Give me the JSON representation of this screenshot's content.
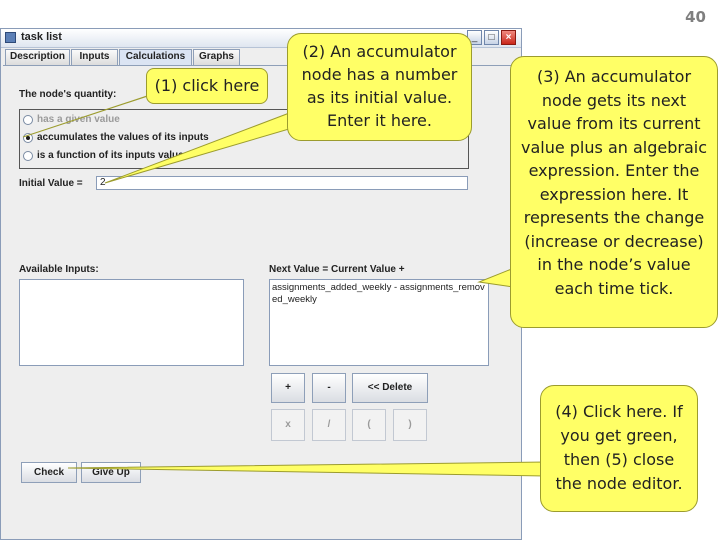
{
  "slide_number": "40",
  "window": {
    "title": "task list",
    "tabs": [
      "Description",
      "Inputs",
      "Calculations",
      "Graphs"
    ],
    "active_tab": "Calculations"
  },
  "quantity": {
    "label": "The node's quantity:",
    "options": [
      {
        "label": "has a given value",
        "selected": false
      },
      {
        "label": "accumulates the values of its inputs",
        "selected": true
      },
      {
        "label": "is a function of its inputs values",
        "selected": false
      }
    ]
  },
  "initial_value": {
    "label": "Initial Value =",
    "value": "2"
  },
  "available_inputs": {
    "label": "Available Inputs:"
  },
  "next_value": {
    "label": "Next Value = Current Value +",
    "expression": "assignments_added_weekly - assignments_removed_weekly"
  },
  "operator_buttons": {
    "plus": "+",
    "minus": "-",
    "delete": "<< Delete",
    "times": "x",
    "divide": "/",
    "open_paren": "(",
    "close_paren": ")"
  },
  "bottom_buttons": {
    "check": "Check",
    "give_up": "Give Up"
  },
  "callouts": {
    "c1": "(1) click here",
    "c2": "(2) An accumulator node has a number as its initial value. Enter it here.",
    "c3": "(3) An accumulator node gets its next value from its current value plus an algebraic expression. Enter the expression here.  It represents the change (increase or decrease) in the node’s value each time tick.",
    "c4": "(4) Click here.  If you get green, then (5) close the node editor."
  },
  "colors": {
    "callout_fill": "#ffff66",
    "callout_border": "#9c9c2e",
    "window_bg": "#eeeeee"
  }
}
